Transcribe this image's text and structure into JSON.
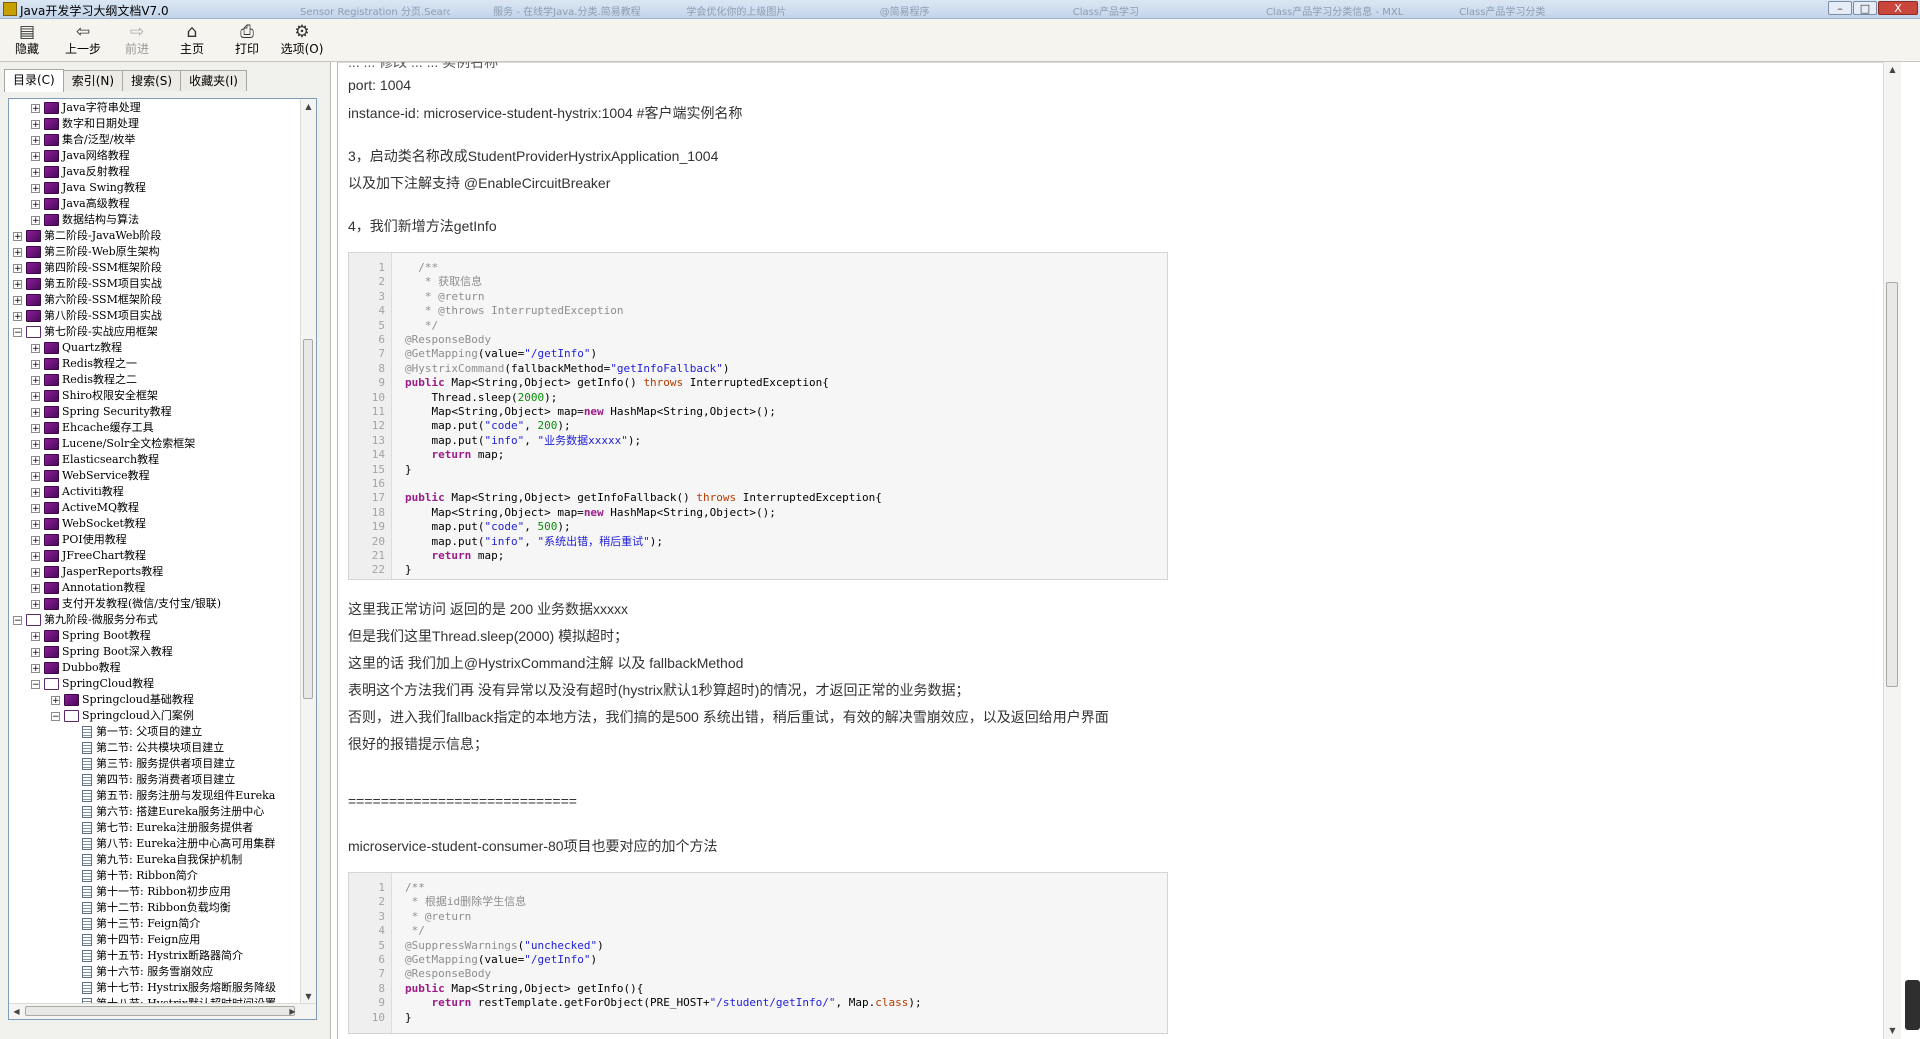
{
  "window": {
    "title": "Java开发学习大纲文档V7.0",
    "ghost_tabs": [
      "Sensor Registration 分页.SearchI",
      "服务 - 在线学Java.分类.简易教程",
      "学会优化你的上级图片",
      "@简易程序",
      "Class产品学习",
      "Class产品学习分类信息 - MXL",
      "Class产品学习分类"
    ],
    "buttons": {
      "minimize": "–",
      "maximize": "□",
      "close": "X"
    }
  },
  "toolbar": {
    "hide": "隐藏",
    "back": "上一步",
    "forward": "前进",
    "home": "主页",
    "print": "打印",
    "options": "选项(O)"
  },
  "nav_tabs": [
    "目录(C)",
    "索引(N)",
    "搜索(S)",
    "收藏夹(I)"
  ],
  "tree": [
    {
      "label": "Java字符串处理",
      "level": 1,
      "kind": "book",
      "exp": "+"
    },
    {
      "label": "数字和日期处理",
      "level": 1,
      "kind": "book",
      "exp": "+"
    },
    {
      "label": "集合/泛型/枚举",
      "level": 1,
      "kind": "book",
      "exp": "+"
    },
    {
      "label": "Java网络教程",
      "level": 1,
      "kind": "book",
      "exp": "+"
    },
    {
      "label": "Java反射教程",
      "level": 1,
      "kind": "book",
      "exp": "+"
    },
    {
      "label": "Java Swing教程",
      "level": 1,
      "kind": "book",
      "exp": "+"
    },
    {
      "label": "Java高级教程",
      "level": 1,
      "kind": "book",
      "exp": "+"
    },
    {
      "label": "数据结构与算法",
      "level": 1,
      "kind": "book",
      "exp": "+"
    },
    {
      "label": "第二阶段-JavaWeb阶段",
      "level": 0,
      "kind": "book",
      "exp": "+"
    },
    {
      "label": "第三阶段-Web原生架构",
      "level": 0,
      "kind": "book",
      "exp": "+"
    },
    {
      "label": "第四阶段-SSM框架阶段",
      "level": 0,
      "kind": "book",
      "exp": "+"
    },
    {
      "label": "第五阶段-SSM项目实战",
      "level": 0,
      "kind": "book",
      "exp": "+"
    },
    {
      "label": "第六阶段-SSM框架阶段",
      "level": 0,
      "kind": "book",
      "exp": "+"
    },
    {
      "label": "第八阶段-SSM项目实战",
      "level": 0,
      "kind": "book",
      "exp": "+"
    },
    {
      "label": "第七阶段-实战应用框架",
      "level": 0,
      "kind": "open",
      "exp": "−"
    },
    {
      "label": "Quartz教程",
      "level": 1,
      "kind": "book",
      "exp": "+"
    },
    {
      "label": "Redis教程之一",
      "level": 1,
      "kind": "book",
      "exp": "+"
    },
    {
      "label": "Redis教程之二",
      "level": 1,
      "kind": "book",
      "exp": "+"
    },
    {
      "label": "Shiro权限安全框架",
      "level": 1,
      "kind": "book",
      "exp": "+"
    },
    {
      "label": "Spring Security教程",
      "level": 1,
      "kind": "book",
      "exp": "+"
    },
    {
      "label": "Ehcache缓存工具",
      "level": 1,
      "kind": "book",
      "exp": "+"
    },
    {
      "label": "Lucene/Solr全文检索框架",
      "level": 1,
      "kind": "book",
      "exp": "+"
    },
    {
      "label": "Elasticsearch教程",
      "level": 1,
      "kind": "book",
      "exp": "+"
    },
    {
      "label": "WebService教程",
      "level": 1,
      "kind": "book",
      "exp": "+"
    },
    {
      "label": "Activiti教程",
      "level": 1,
      "kind": "book",
      "exp": "+"
    },
    {
      "label": "ActiveMQ教程",
      "level": 1,
      "kind": "book",
      "exp": "+"
    },
    {
      "label": "WebSocket教程",
      "level": 1,
      "kind": "book",
      "exp": "+"
    },
    {
      "label": "POI使用教程",
      "level": 1,
      "kind": "book",
      "exp": "+"
    },
    {
      "label": "JFreeChart教程",
      "level": 1,
      "kind": "book",
      "exp": "+"
    },
    {
      "label": "JasperReports教程",
      "level": 1,
      "kind": "book",
      "exp": "+"
    },
    {
      "label": "Annotation教程",
      "level": 1,
      "kind": "book",
      "exp": "+"
    },
    {
      "label": "支付开发教程(微信/支付宝/银联)",
      "level": 1,
      "kind": "book",
      "exp": "+"
    },
    {
      "label": "第九阶段-微服务分布式",
      "level": 0,
      "kind": "open",
      "exp": "−"
    },
    {
      "label": "Spring Boot教程",
      "level": 1,
      "kind": "book",
      "exp": "+"
    },
    {
      "label": "Spring Boot深入教程",
      "level": 1,
      "kind": "book",
      "exp": "+"
    },
    {
      "label": "Dubbo教程",
      "level": 1,
      "kind": "book",
      "exp": "+"
    },
    {
      "label": "SpringCloud教程",
      "level": 1,
      "kind": "open",
      "exp": "−"
    },
    {
      "label": "Springcloud基础教程",
      "level": 2,
      "kind": "book",
      "exp": "+"
    },
    {
      "label": "Springcloud入门案例",
      "level": 2,
      "kind": "open",
      "exp": "−"
    },
    {
      "label": "第一节: 父项目的建立",
      "level": 3,
      "kind": "page",
      "exp": ""
    },
    {
      "label": "第二节: 公共模块项目建立",
      "level": 3,
      "kind": "page",
      "exp": ""
    },
    {
      "label": "第三节: 服务提供者项目建立",
      "level": 3,
      "kind": "page",
      "exp": ""
    },
    {
      "label": "第四节: 服务消费者项目建立",
      "level": 3,
      "kind": "page",
      "exp": ""
    },
    {
      "label": "第五节: 服务注册与发现组件Eureka",
      "level": 3,
      "kind": "page",
      "exp": ""
    },
    {
      "label": "第六节: 搭建Eureka服务注册中心",
      "level": 3,
      "kind": "page",
      "exp": ""
    },
    {
      "label": "第七节: Eureka注册服务提供者",
      "level": 3,
      "kind": "page",
      "exp": ""
    },
    {
      "label": "第八节: Eureka注册中心高可用集群",
      "level": 3,
      "kind": "page",
      "exp": ""
    },
    {
      "label": "第九节: Eureka自我保护机制",
      "level": 3,
      "kind": "page",
      "exp": ""
    },
    {
      "label": "第十节: Ribbon简介",
      "level": 3,
      "kind": "page",
      "exp": ""
    },
    {
      "label": "第十一节: Ribbon初步应用",
      "level": 3,
      "kind": "page",
      "exp": ""
    },
    {
      "label": "第十二节: Ribbon负载均衡",
      "level": 3,
      "kind": "page",
      "exp": ""
    },
    {
      "label": "第十三节: Feign简介",
      "level": 3,
      "kind": "page",
      "exp": ""
    },
    {
      "label": "第十四节: Feign应用",
      "level": 3,
      "kind": "page",
      "exp": ""
    },
    {
      "label": "第十五节: Hystrix断路器简介",
      "level": 3,
      "kind": "page",
      "exp": ""
    },
    {
      "label": "第十六节: 服务雪崩效应",
      "level": 3,
      "kind": "page",
      "exp": ""
    },
    {
      "label": "第十七节: Hystrix服务熔断服务降级",
      "level": 3,
      "kind": "page",
      "exp": ""
    },
    {
      "label": "第十八节: Hystrix默认超时时间设置",
      "level": 3,
      "kind": "page",
      "exp": ""
    }
  ],
  "content": {
    "cut_line": "   ... ... 修改 ... ... 实例名称",
    "port": "port: 1004",
    "instance_id": "  instance-id: microservice-student-hystrix:1004 #客户端实例名称",
    "step3": "3，启动类名称改成StudentProviderHystrixApplication_1004",
    "step3b": "以及加下注解支持 @EnableCircuitBreaker",
    "step4": "4，我们新增方法getInfo",
    "para1": "这里我正常访问  返回的是  200  业务数据xxxxx",
    "para2": "但是我们这里Thread.sleep(2000) 模拟超时；",
    "para3": "这里的话  我们加上@HystrixCommand注解  以及  fallbackMethod",
    "para4": "表明这个方法我们再  没有异常以及没有超时(hystrix默认1秒算超时)的情况，才返回正常的业务数据；",
    "para5": "否则，进入我们fallback指定的本地方法，我们搞的是500  系统出错，稍后重试，有效的解决雪崩效应，以及返回给用户界面",
    "para6": "很好的报错提示信息；",
    "separator": "============================",
    "consumer": "microservice-student-consumer-80项目也要对应的加个方法"
  },
  "code1": [
    [
      [
        "c-cm",
        "  /**"
      ]
    ],
    [
      [
        "c-cm",
        "   * 获取信息"
      ]
    ],
    [
      [
        "c-cm",
        "   * @return"
      ]
    ],
    [
      [
        "c-cm",
        "   * @throws InterruptedException"
      ]
    ],
    [
      [
        "c-cm",
        "   */"
      ]
    ],
    [
      [
        "c-an",
        "@ResponseBody"
      ]
    ],
    [
      [
        "c-an",
        "@GetMapping"
      ],
      [
        "c-pl",
        "(value="
      ],
      [
        "c-st",
        "\"/getInfo\""
      ],
      [
        "c-pl",
        ")"
      ]
    ],
    [
      [
        "c-an",
        "@HystrixCommand"
      ],
      [
        "c-pl",
        "(fallbackMethod="
      ],
      [
        "c-st",
        "\"getInfoFallback\""
      ],
      [
        "c-pl",
        ")"
      ]
    ],
    [
      [
        "c-kw",
        "public"
      ],
      [
        "c-pl",
        " Map<String,Object> getInfo() "
      ],
      [
        "c-ty",
        "throws"
      ],
      [
        "c-pl",
        " InterruptedException{"
      ]
    ],
    [
      [
        "c-pl",
        "    Thread.sleep("
      ],
      [
        "c-nu",
        "2000"
      ],
      [
        "c-pl",
        ");"
      ]
    ],
    [
      [
        "c-pl",
        "    Map<String,Object> map="
      ],
      [
        "c-kw",
        "new"
      ],
      [
        "c-pl",
        " HashMap<String,Object>();"
      ]
    ],
    [
      [
        "c-pl",
        "    map.put("
      ],
      [
        "c-st",
        "\"code\""
      ],
      [
        "c-pl",
        ", "
      ],
      [
        "c-nu",
        "200"
      ],
      [
        "c-pl",
        ");"
      ]
    ],
    [
      [
        "c-pl",
        "    map.put("
      ],
      [
        "c-st",
        "\"info\""
      ],
      [
        "c-pl",
        ", "
      ],
      [
        "c-st",
        "\"业务数据xxxxx\""
      ],
      [
        "c-pl",
        ");"
      ]
    ],
    [
      [
        "c-pl",
        "    "
      ],
      [
        "c-kw",
        "return"
      ],
      [
        "c-pl",
        " map;"
      ]
    ],
    [
      [
        "c-pl",
        "}"
      ]
    ],
    [
      [
        "c-pl",
        ""
      ]
    ],
    [
      [
        "c-kw",
        "public"
      ],
      [
        "c-pl",
        " Map<String,Object> getInfoFallback() "
      ],
      [
        "c-ty",
        "throws"
      ],
      [
        "c-pl",
        " InterruptedException{"
      ]
    ],
    [
      [
        "c-pl",
        "    Map<String,Object> map="
      ],
      [
        "c-kw",
        "new"
      ],
      [
        "c-pl",
        " HashMap<String,Object>();"
      ]
    ],
    [
      [
        "c-pl",
        "    map.put("
      ],
      [
        "c-st",
        "\"code\""
      ],
      [
        "c-pl",
        ", "
      ],
      [
        "c-nu",
        "500"
      ],
      [
        "c-pl",
        ");"
      ]
    ],
    [
      [
        "c-pl",
        "    map.put("
      ],
      [
        "c-st",
        "\"info\""
      ],
      [
        "c-pl",
        ", "
      ],
      [
        "c-st",
        "\"系统出错，稍后重试\""
      ],
      [
        "c-pl",
        ");"
      ]
    ],
    [
      [
        "c-pl",
        "    "
      ],
      [
        "c-kw",
        "return"
      ],
      [
        "c-pl",
        " map;"
      ]
    ],
    [
      [
        "c-pl",
        "}"
      ]
    ]
  ],
  "code2": [
    [
      [
        "c-cm",
        "/**"
      ]
    ],
    [
      [
        "c-cm",
        " * 根据id删除学生信息"
      ]
    ],
    [
      [
        "c-cm",
        " * @return"
      ]
    ],
    [
      [
        "c-cm",
        " */"
      ]
    ],
    [
      [
        "c-an",
        "@SuppressWarnings"
      ],
      [
        "c-pl",
        "("
      ],
      [
        "c-st",
        "\"unchecked\""
      ],
      [
        "c-pl",
        ")"
      ]
    ],
    [
      [
        "c-an",
        "@GetMapping"
      ],
      [
        "c-pl",
        "(value="
      ],
      [
        "c-st",
        "\"/getInfo\""
      ],
      [
        "c-pl",
        ")"
      ]
    ],
    [
      [
        "c-an",
        "@ResponseBody"
      ]
    ],
    [
      [
        "c-kw",
        "public"
      ],
      [
        "c-pl",
        " Map<String,Object> getInfo(){"
      ]
    ],
    [
      [
        "c-pl",
        "    "
      ],
      [
        "c-kw",
        "return"
      ],
      [
        "c-pl",
        " restTemplate.getForObject(PRE_HOST+"
      ],
      [
        "c-st",
        "\"/student/getInfo/\""
      ],
      [
        "c-pl",
        ", Map."
      ],
      [
        "c-ty",
        "class"
      ],
      [
        "c-pl",
        ");"
      ]
    ],
    [
      [
        "c-pl",
        "}"
      ]
    ]
  ],
  "colors": {
    "keyword": "#9d1b8a",
    "string": "#2121d8",
    "number": "#0b8b0b",
    "comment": "#8e8e8e",
    "book": "#8d1e9c"
  }
}
